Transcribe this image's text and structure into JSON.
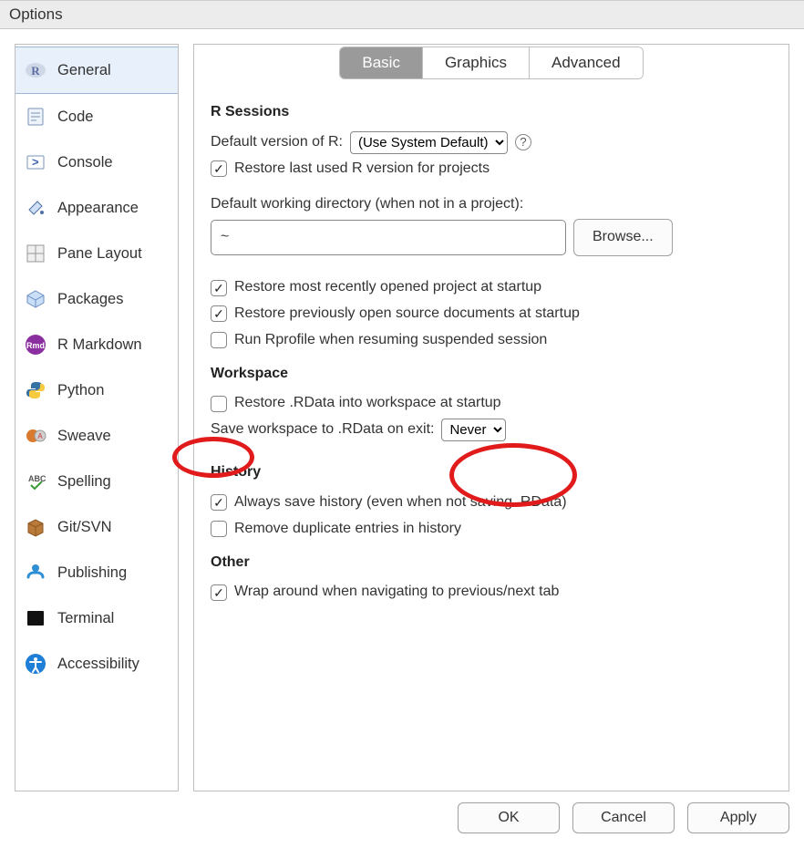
{
  "window": {
    "title": "Options"
  },
  "sidebar": {
    "items": [
      {
        "label": "General",
        "icon": "r-logo",
        "selected": true
      },
      {
        "label": "Code",
        "icon": "code-file",
        "selected": false
      },
      {
        "label": "Console",
        "icon": "prompt",
        "selected": false
      },
      {
        "label": "Appearance",
        "icon": "paint-bucket",
        "selected": false
      },
      {
        "label": "Pane Layout",
        "icon": "panes",
        "selected": false
      },
      {
        "label": "Packages",
        "icon": "package-box",
        "selected": false
      },
      {
        "label": "R Markdown",
        "icon": "rmd-badge",
        "selected": false
      },
      {
        "label": "Python",
        "icon": "python-logo",
        "selected": false
      },
      {
        "label": "Sweave",
        "icon": "sweave",
        "selected": false
      },
      {
        "label": "Spelling",
        "icon": "abc-check",
        "selected": false
      },
      {
        "label": "Git/SVN",
        "icon": "git-box",
        "selected": false
      },
      {
        "label": "Publishing",
        "icon": "publish-cloud",
        "selected": false
      },
      {
        "label": "Terminal",
        "icon": "terminal",
        "selected": false
      },
      {
        "label": "Accessibility",
        "icon": "accessibility",
        "selected": false
      }
    ]
  },
  "tabs": [
    {
      "label": "Basic",
      "active": true
    },
    {
      "label": "Graphics",
      "active": false
    },
    {
      "label": "Advanced",
      "active": false
    }
  ],
  "sections": {
    "r_sessions": {
      "heading": "R Sessions",
      "default_r_label": "Default version of R:",
      "default_r_value": "(Use System Default)",
      "restore_r_version": {
        "label": "Restore last used R version for projects",
        "checked": true
      },
      "wd_label": "Default working directory (when not in a project):",
      "wd_value": "~",
      "browse": "Browse...",
      "restore_project": {
        "label": "Restore most recently opened project at startup",
        "checked": true
      },
      "restore_docs": {
        "label": "Restore previously open source documents at startup",
        "checked": true
      },
      "run_rprofile": {
        "label": "Run Rprofile when resuming suspended session",
        "checked": false
      }
    },
    "workspace": {
      "heading": "Workspace",
      "restore_rdata": {
        "label": "Restore .RData into workspace at startup",
        "checked": false
      },
      "save_ws_label": "Save workspace to .RData on exit:",
      "save_ws_value": "Never"
    },
    "history": {
      "heading": "History",
      "always_save": {
        "label": "Always save history (even when not saving .RData)",
        "checked": true
      },
      "remove_dups": {
        "label": "Remove duplicate entries in history",
        "checked": false
      }
    },
    "other": {
      "heading": "Other",
      "wrap_tabs": {
        "label": "Wrap around when navigating to previous/next tab",
        "checked": true
      }
    }
  },
  "buttons": {
    "ok": "OK",
    "cancel": "Cancel",
    "apply": "Apply"
  },
  "annotations": [
    {
      "target": "restore-rdata-checkbox",
      "purpose": "highlight"
    },
    {
      "target": "save-workspace-select",
      "purpose": "highlight"
    }
  ]
}
